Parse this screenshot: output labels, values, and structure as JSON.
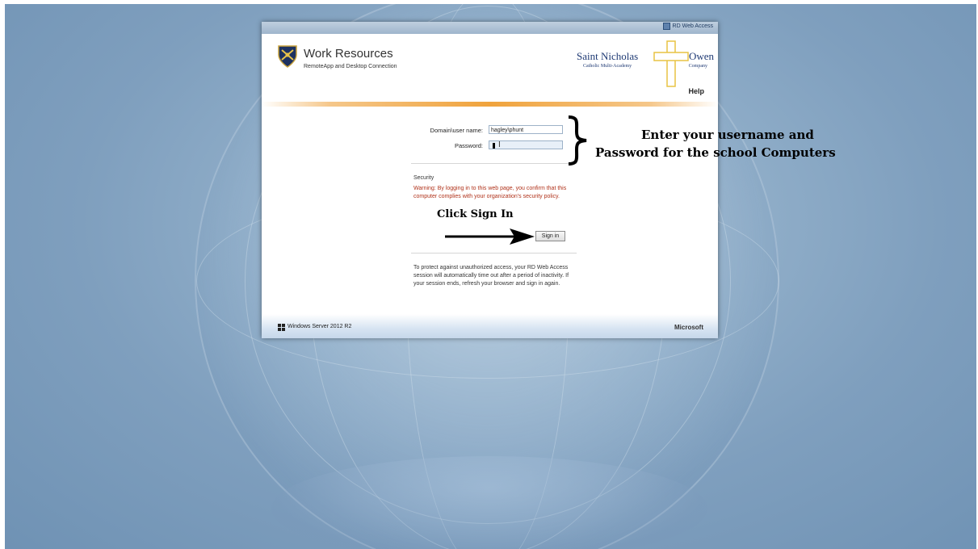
{
  "window": {
    "top_link": "RD Web Access",
    "title": "Work Resources",
    "subtitle": "RemoteApp and Desktop Connection",
    "help": "Help"
  },
  "logo": {
    "name_left": "Saint Nicholas",
    "name_right": "Owen",
    "sub_left": "Catholic Multi-Academy",
    "sub_right": "Company",
    "colors": {
      "text": "#1f3a74",
      "cross": "#e8c343"
    }
  },
  "form": {
    "username_label": "Domain\\user name:",
    "username_value": "hagley\\phunt",
    "password_label": "Password:",
    "password_value": ""
  },
  "security": {
    "heading": "Security",
    "warning": "Warning: By logging in to this web page, you confirm that this computer complies with your organization's security policy.",
    "warning_color": "#b0321a"
  },
  "signin_label": "Sign in",
  "notice": "To protect against unauthorized access, your RD Web Access session will automatically time out after a period of inactivity. If your session ends, refresh your browser and sign in again.",
  "footer": {
    "os": "Windows Server 2012 R2",
    "vendor": "Microsoft"
  },
  "annotations": {
    "line1": "Enter your username and",
    "line2": "Password for the school Computers",
    "click": "Click Sign In"
  },
  "colors": {
    "accent_divider": "#f0a33c",
    "background": "#8fadc8"
  }
}
